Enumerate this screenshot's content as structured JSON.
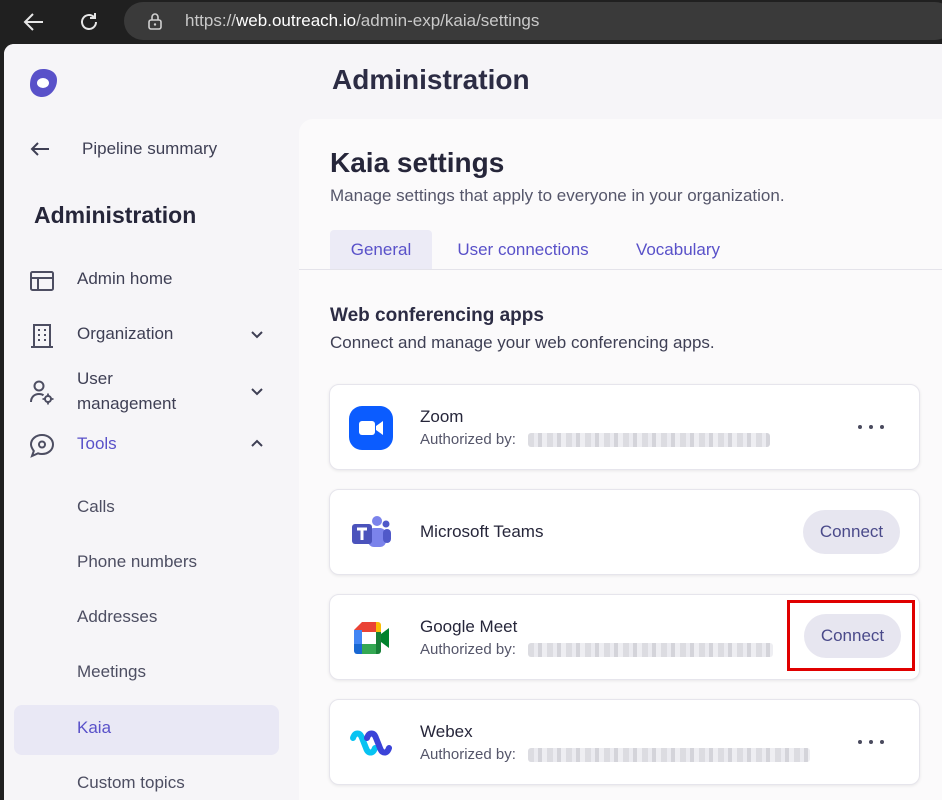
{
  "browser": {
    "url_prefix": "https://",
    "url_host": "web.outreach.io",
    "url_path": "/admin-exp/kaia/settings"
  },
  "sidebar": {
    "back_label": "Pipeline summary",
    "title": "Administration",
    "items": [
      {
        "label": "Admin home",
        "icon": "layout-icon"
      },
      {
        "label": "Organization",
        "icon": "building-icon"
      },
      {
        "label": "User management",
        "icon": "user-gear-icon"
      },
      {
        "label": "Tools",
        "icon": "tools-chat-icon"
      }
    ],
    "tools_subitems": [
      "Calls",
      "Phone numbers",
      "Addresses",
      "Meetings",
      "Kaia",
      "Custom topics"
    ],
    "selected_subitem": "Kaia"
  },
  "main": {
    "page_title": "Administration",
    "panel_title": "Kaia settings",
    "panel_subtitle": "Manage settings that apply to everyone in your organization.",
    "tabs": [
      {
        "label": "General",
        "active": true
      },
      {
        "label": "User connections",
        "active": false
      },
      {
        "label": "Vocabulary",
        "active": false
      }
    ],
    "section_title": "Web conferencing apps",
    "section_subtitle": "Connect and manage your web conferencing apps.",
    "apps": [
      {
        "name": "Zoom",
        "authorized_label": "Authorized by:",
        "action": "more"
      },
      {
        "name": "Microsoft Teams",
        "authorized_label": "",
        "action": "Connect"
      },
      {
        "name": "Google Meet",
        "authorized_label": "Authorized by:",
        "action": "Connect"
      },
      {
        "name": "Webex",
        "authorized_label": "Authorized by:",
        "action": "more"
      }
    ]
  },
  "colors": {
    "accent": "#5951c9",
    "highlight": "#e00000"
  }
}
